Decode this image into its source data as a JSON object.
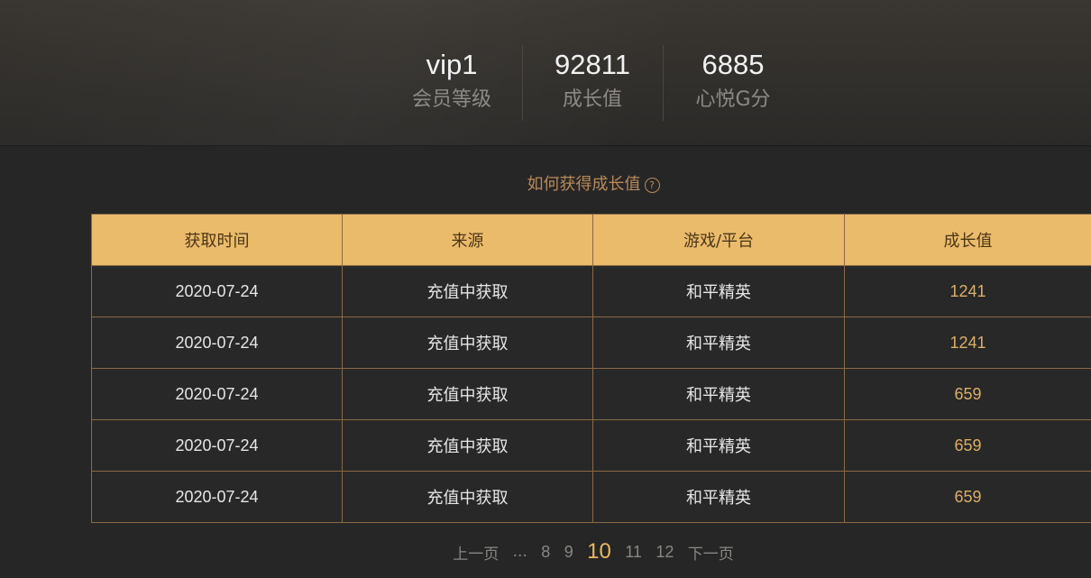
{
  "stats": [
    {
      "value": "vip1",
      "label": "会员等级"
    },
    {
      "value": "92811",
      "label": "成长值"
    },
    {
      "value": "6885",
      "label": "心悦G分"
    }
  ],
  "help": {
    "text": "如何获得成长值",
    "icon": "question-circle-icon"
  },
  "table": {
    "headers": [
      "获取时间",
      "来源",
      "游戏/平台",
      "成长值"
    ],
    "rows": [
      [
        "2020-07-24",
        "充值中获取",
        "和平精英",
        "1241"
      ],
      [
        "2020-07-24",
        "充值中获取",
        "和平精英",
        "1241"
      ],
      [
        "2020-07-24",
        "充值中获取",
        "和平精英",
        "659"
      ],
      [
        "2020-07-24",
        "充值中获取",
        "和平精英",
        "659"
      ],
      [
        "2020-07-24",
        "充值中获取",
        "和平精英",
        "659"
      ]
    ]
  },
  "pagination": {
    "prev": "上一页",
    "ellipsis": "...",
    "pages": [
      "8",
      "9",
      "10",
      "11",
      "12"
    ],
    "current": "10",
    "next": "下一页"
  },
  "colors": {
    "header_bg": "#ebbb6c",
    "accent": "#dcae64",
    "help_text": "#b98a5b",
    "background": "#262626"
  }
}
